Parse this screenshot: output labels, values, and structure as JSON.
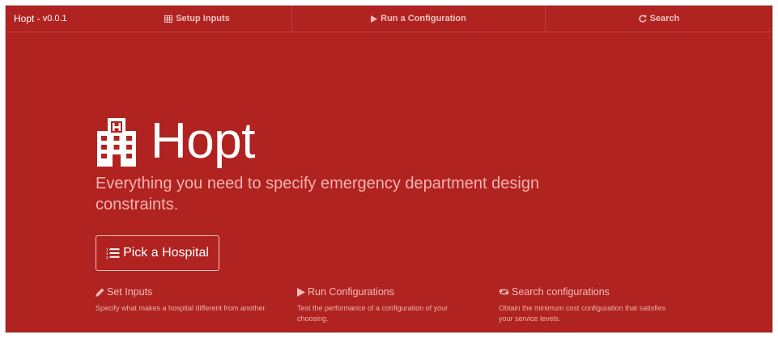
{
  "navbar": {
    "brand": "Hopt -",
    "version": "v0.0.1",
    "items": [
      {
        "label": "Setup Inputs",
        "icon": "table-icon"
      },
      {
        "label": "Run a Configuration",
        "icon": "play-icon"
      },
      {
        "label": "Search",
        "icon": "refresh-icon"
      }
    ]
  },
  "hero": {
    "icon": "hospital-icon",
    "title": "Hopt",
    "tagline": "Everything you need to specify emergency department design constraints.",
    "button_label": "Pick a Hospital",
    "button_icon": "list-ol-icon"
  },
  "features": [
    {
      "icon": "pencil-icon",
      "title": "Set Inputs",
      "description": "Specify what makes a hospital different from another."
    },
    {
      "icon": "play-icon",
      "title": "Run Configurations",
      "description": "Test the performance of a configuration of your choosing."
    },
    {
      "icon": "retweet-icon",
      "title": "Search configurations",
      "description": "Obtain the minimum cost configuration that satisfies your service levels."
    }
  ],
  "colors": {
    "background": "#b02320",
    "text": "#ffffff",
    "muted_text": "#f4b3ad"
  }
}
